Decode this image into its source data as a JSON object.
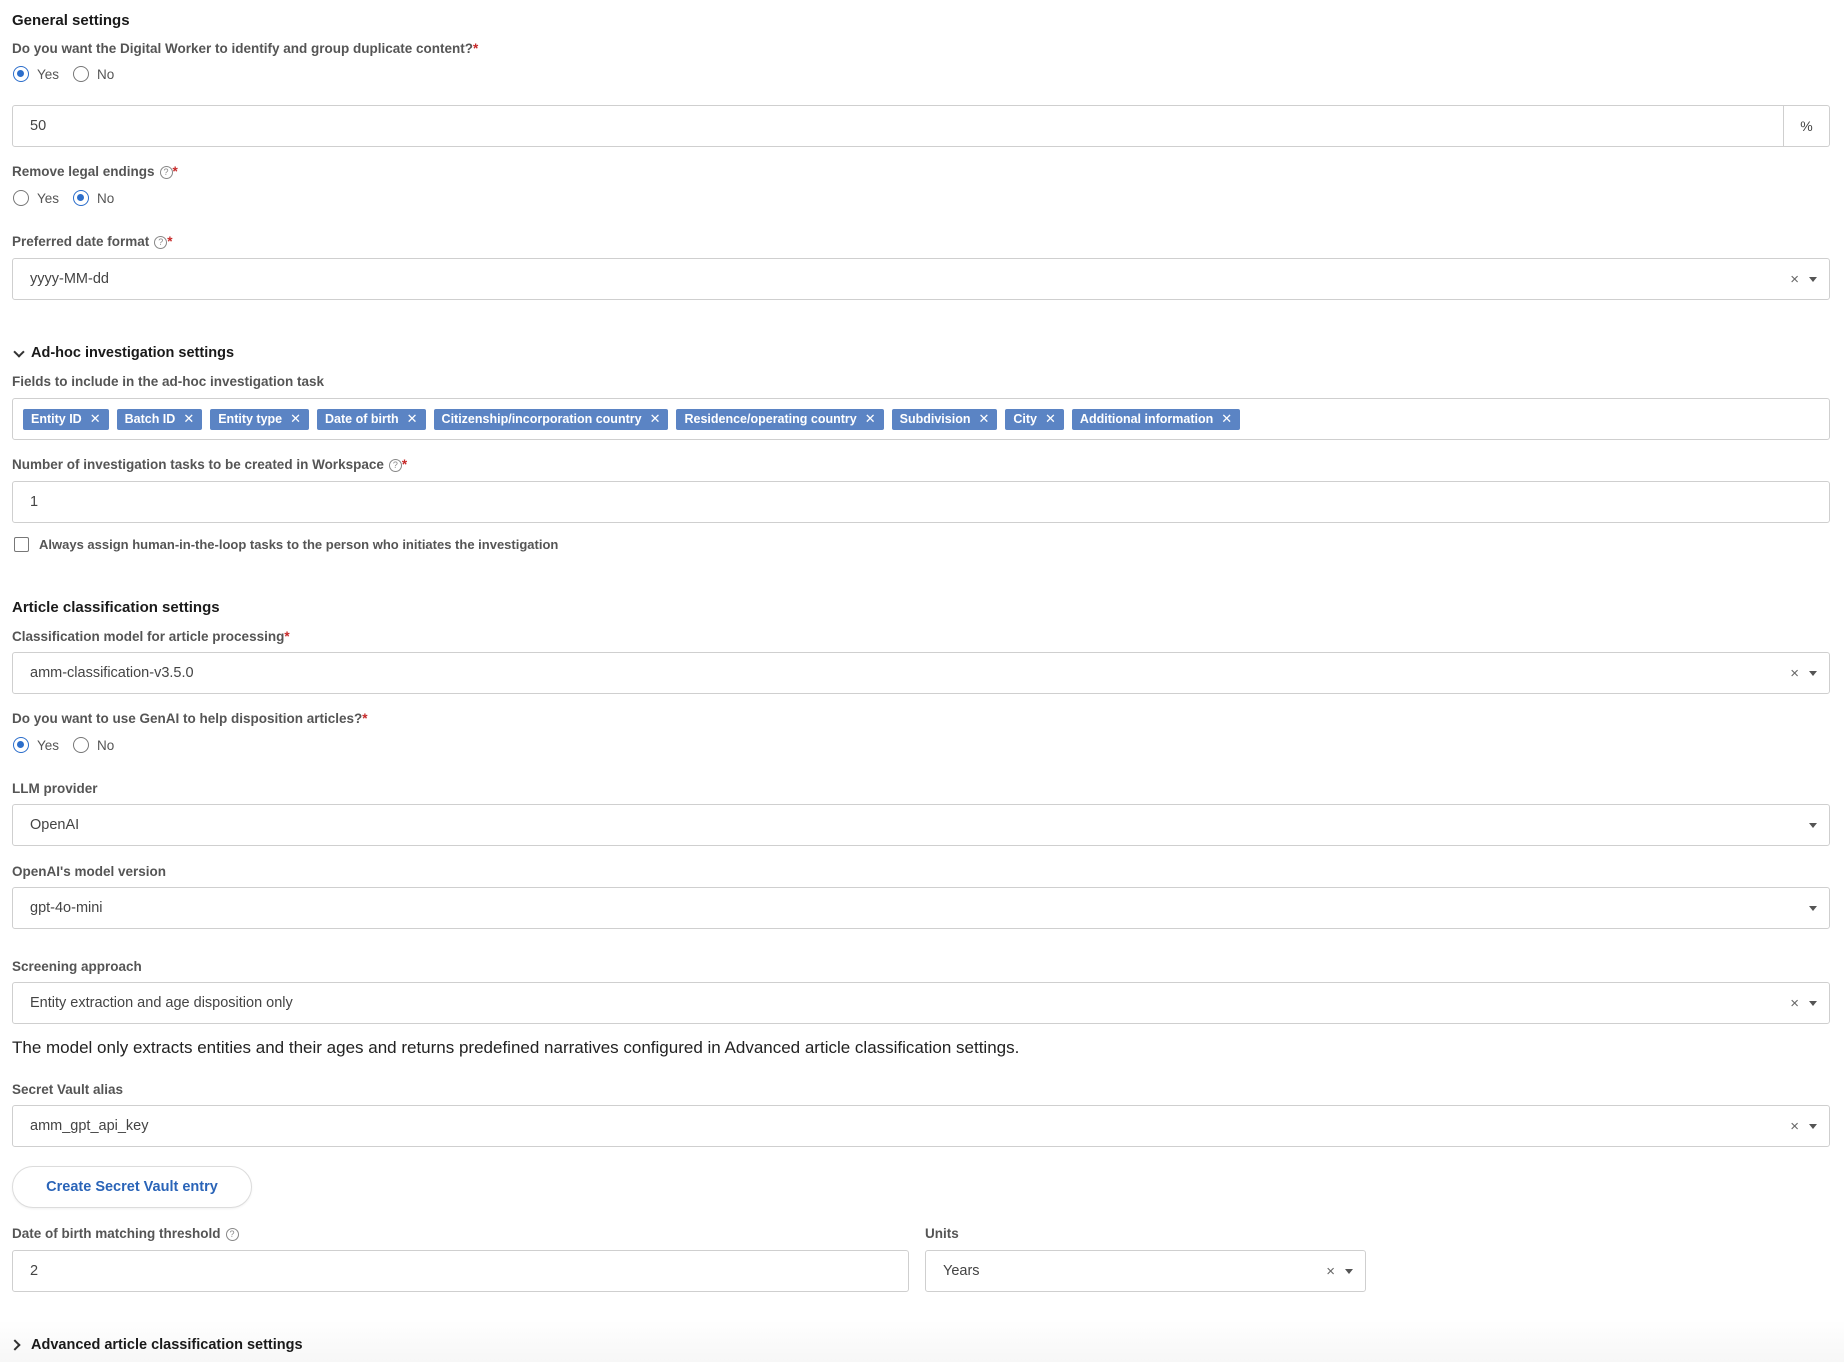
{
  "general": {
    "title": "General settings",
    "duplicate_q": "Do you want the Digital Worker to identify and group duplicate content?",
    "duplicate_options": [
      "Yes",
      "No"
    ],
    "duplicate_selected": "Yes",
    "threshold_value": "50",
    "threshold_unit": "%",
    "legal_endings_label": "Remove legal endings",
    "legal_endings_options": [
      "Yes",
      "No"
    ],
    "legal_endings_selected": "No",
    "date_format_label": "Preferred date format",
    "date_format_value": "yyyy-MM-dd"
  },
  "adhoc": {
    "title": "Ad-hoc investigation settings",
    "fields_label": "Fields to include in the ad-hoc investigation task",
    "chips": [
      "Entity ID",
      "Batch ID",
      "Entity type",
      "Date of birth",
      "Citizenship/incorporation country",
      "Residence/operating country",
      "Subdivision",
      "City",
      "Additional information"
    ],
    "tasks_label": "Number of investigation tasks to be created in Workspace",
    "tasks_value": "1",
    "assign_label": "Always assign human-in-the-loop tasks to the person who initiates the investigation"
  },
  "article": {
    "title": "Article classification settings",
    "model_label": "Classification model for article processing",
    "model_value": "amm-classification-v3.5.0",
    "genai_q": "Do you want to use GenAI to help disposition articles?",
    "genai_options": [
      "Yes",
      "No"
    ],
    "genai_selected": "Yes",
    "llm_label": "LLM provider",
    "llm_value": "OpenAI",
    "model_version_label": "OpenAI's model version",
    "model_version_value": "gpt-4o-mini",
    "screening_label": "Screening approach",
    "screening_value": "Entity extraction and age disposition only",
    "screening_desc": "The model only extracts entities and their ages and returns predefined narratives configured in Advanced article classification settings.",
    "vault_label": "Secret Vault alias",
    "vault_value": "amm_gpt_api_key",
    "create_vault_button": "Create Secret Vault entry",
    "dob_label": "Date of birth matching threshold",
    "dob_value": "2",
    "units_label": "Units",
    "units_value": "Years"
  },
  "advanced": {
    "title": "Advanced article classification settings"
  },
  "icons": {
    "help": "question-circle-icon",
    "clear": "clear-x-icon",
    "caret": "caret-down-icon"
  },
  "colors": {
    "accent": "#2c6ecb",
    "chip_bg": "#5b84c4",
    "required": "#c62828",
    "link": "#2a64b8"
  }
}
